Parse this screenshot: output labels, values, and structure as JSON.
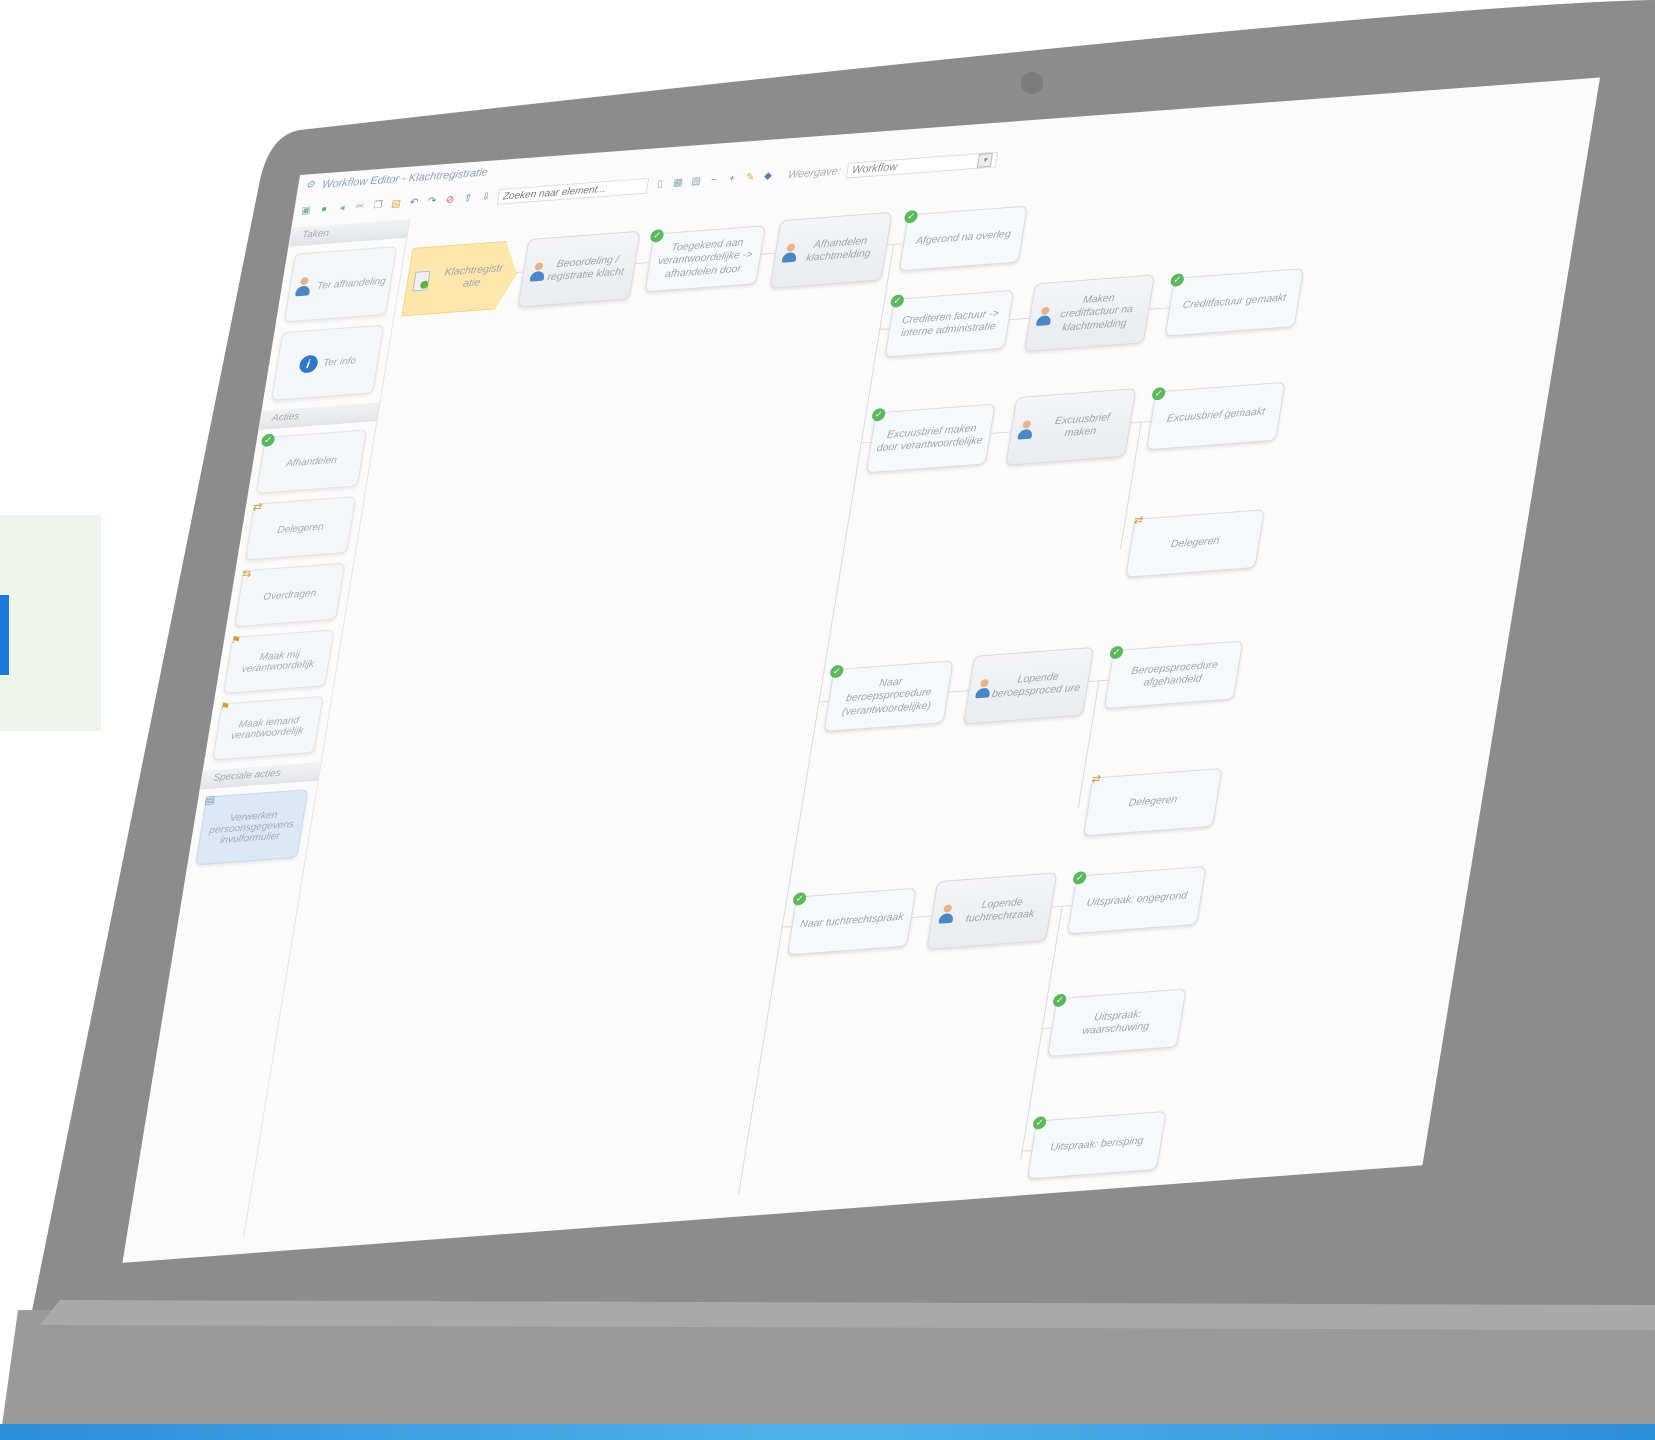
{
  "window": {
    "title": "Workflow Editor - Klachtregistratie"
  },
  "toolbar": {
    "search_placeholder": "Zoeken naar element...",
    "view_label": "Weergave:",
    "view_value": "Workflow"
  },
  "sidebar": {
    "tasks_header": "Taken",
    "tasks": [
      {
        "label": "Ter afhandeling",
        "icon": "person-icon"
      },
      {
        "label": "Ter info",
        "icon": "info-icon"
      }
    ],
    "actions_header": "Acties",
    "actions": [
      {
        "label": "Afhandelen",
        "icon": "check-icon"
      },
      {
        "label": "Delegeren",
        "icon": "delegate-icon"
      },
      {
        "label": "Overdragen",
        "icon": "transfer-icon"
      },
      {
        "label": "Maak mij verantwoordelijk",
        "icon": "responsible-icon"
      },
      {
        "label": "Maak iemand verantwoordelijk",
        "icon": "responsible-icon"
      }
    ],
    "special_header": "Speciale acties",
    "special_actions": [
      {
        "label": "Verwerken persoonsgegevens invulformulier",
        "icon": "form-icon"
      }
    ]
  },
  "workflow": {
    "start": "Klachtregistr atie",
    "beoordeling": "Beoordeling / registratie klacht",
    "toegekend": "Toegekend aan verantwoordelijke -> afhandelen door",
    "afhandelen": "Afhandelen klachtmelding",
    "afgerond": "Afgerond na overleg",
    "crediteren": "Crediteren factuur -> interne administratie",
    "maken_credit": "Maken creditfactuur na klachtmelding",
    "credit_gemaakt": "Creditfactuur gemaakt",
    "excuus_door": "Excuusbrief maken door verantwoordelijke",
    "excuus_maken": "Excuusbrief maken",
    "excuus_gemaakt": "Excuusbrief gemaakt",
    "delegeren_1": "Delegeren",
    "naar_beroep": "Naar beroepsprocedure (verantwoordelijke)",
    "lopende_beroep": "Lopende beroepsproced ure",
    "beroep_afgehandeld": "Beroepsprocedure afgehandeld",
    "delegeren_2": "Delegeren",
    "naar_tucht": "Naar tuchtrechtspraak",
    "lopende_tucht": "Lopende tuchtrechtzaak",
    "uitspraak_ongegrond": "Uitspraak: ongegrond",
    "uitspraak_waarschuwing": "Uitspraak: waarschuwing",
    "uitspraak_berisping": "Uitspraak: berisping"
  },
  "colors": {
    "bezel": "#8c8c8c",
    "accent": "#1a7bd8",
    "start_node": "#fde7ad",
    "check": "#5cb85c"
  }
}
